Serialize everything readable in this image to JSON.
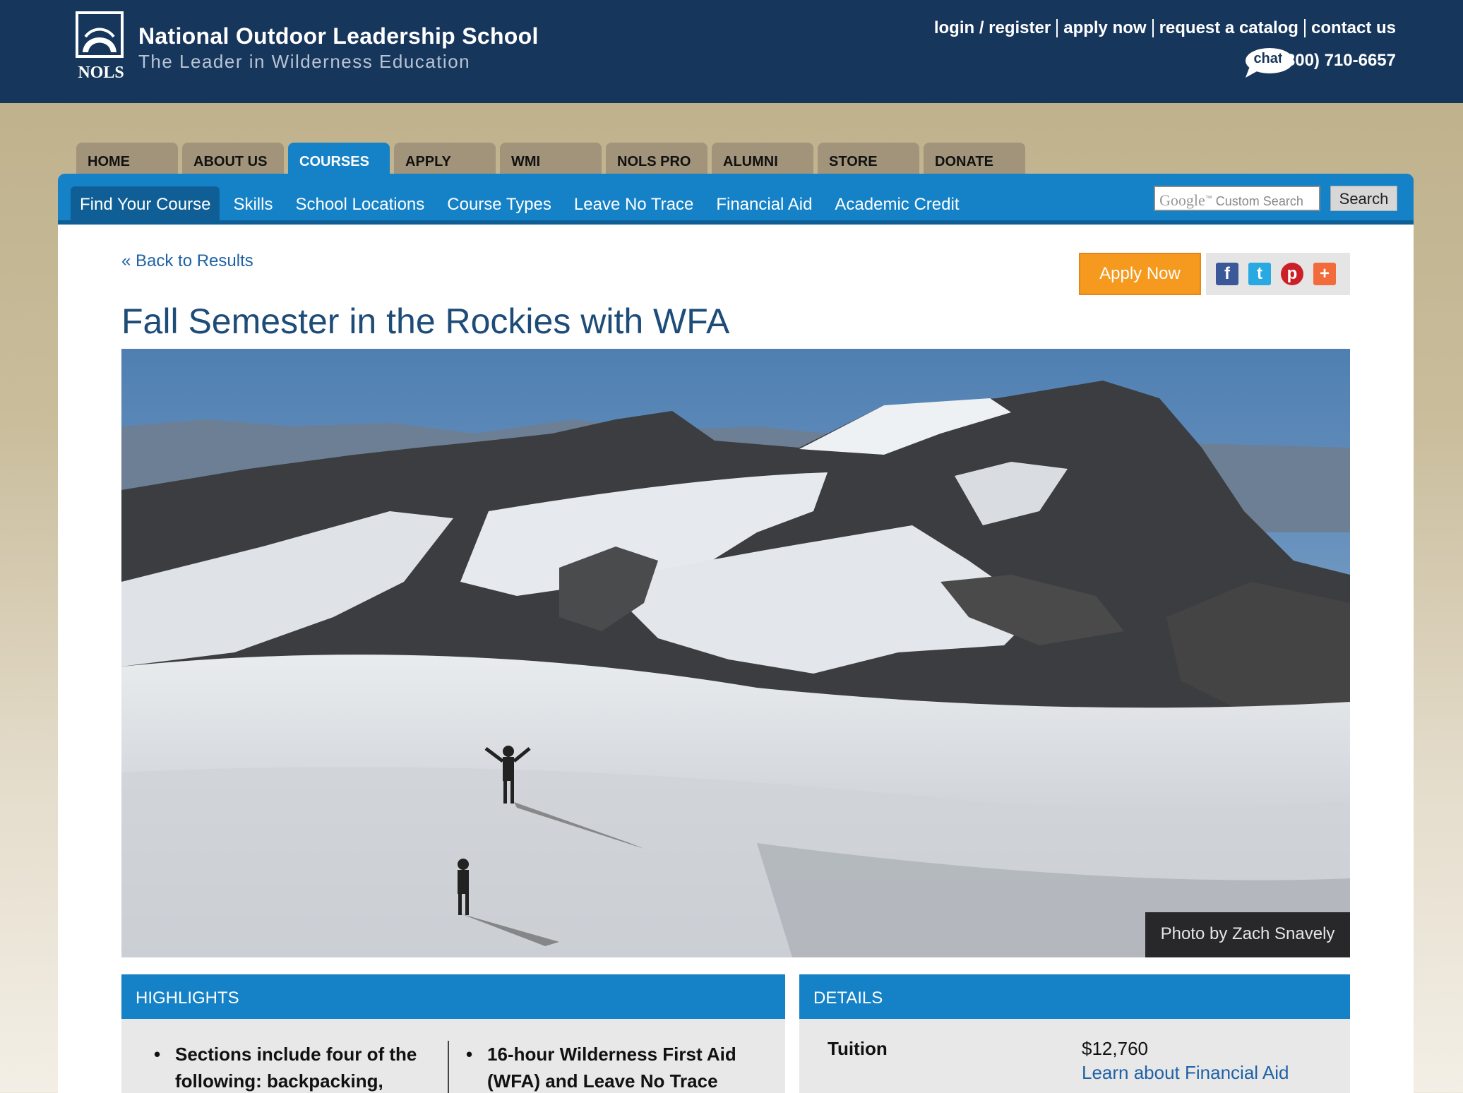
{
  "header": {
    "logo_title": "National Outdoor Leadership School",
    "logo_tagline": "The Leader in Wilderness Education",
    "logo_mark_text": "NOLS",
    "utility_links": [
      "login / register",
      "apply now",
      "request a catalog",
      "contact us"
    ],
    "chat_label": "chat",
    "phone": "(800) 710-6657",
    "colors": {
      "navy": "#17365c",
      "blue": "#1581c6",
      "orange": "#f59a1e"
    }
  },
  "primary_tabs": [
    {
      "label": "HOME",
      "active": false
    },
    {
      "label": "ABOUT US",
      "active": false
    },
    {
      "label": "COURSES",
      "active": true
    },
    {
      "label": "APPLY",
      "active": false
    },
    {
      "label": "WMI",
      "active": false
    },
    {
      "label": "NOLS PRO",
      "active": false
    },
    {
      "label": "ALUMNI",
      "active": false
    },
    {
      "label": "STORE",
      "active": false
    },
    {
      "label": "DONATE",
      "active": false
    }
  ],
  "subnav": [
    {
      "label": "Find Your Course",
      "active": true
    },
    {
      "label": "Skills",
      "active": false
    },
    {
      "label": "School Locations",
      "active": false
    },
    {
      "label": "Course Types",
      "active": false
    },
    {
      "label": "Leave No Trace",
      "active": false
    },
    {
      "label": "Financial Aid",
      "active": false
    },
    {
      "label": "Academic Credit",
      "active": false
    }
  ],
  "search": {
    "brand": "Google",
    "tm": "™",
    "placeholder": "Custom Search",
    "button_label": "Search"
  },
  "page": {
    "back_link": "« Back to Results",
    "apply_label": "Apply Now",
    "share_icons": [
      "facebook-icon",
      "twitter-icon",
      "pinterest-icon",
      "add-share-icon"
    ],
    "share_glyphs": [
      "f",
      "t",
      "p",
      "+"
    ],
    "title": "Fall Semester in the Rockies with WFA",
    "photo_caption": "Photo by Zach Snavely"
  },
  "highlights": {
    "heading": "HIGHLIGHTS",
    "items": [
      {
        "line1": "Sections include four of the",
        "line2": "following: backpacking,"
      },
      {
        "line1": "16-hour Wilderness First Aid",
        "line2": "(WFA) and Leave No Trace"
      }
    ]
  },
  "details": {
    "heading": "DETAILS",
    "tuition_label": "Tuition",
    "tuition_value": "$12,760",
    "financial_aid_link": "Learn about Financial Aid"
  }
}
